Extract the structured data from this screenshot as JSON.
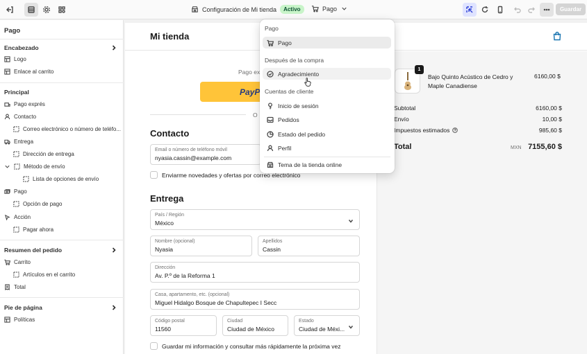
{
  "topbar": {
    "store_title": "Configuración de Mi tienda",
    "status_badge": "Activo",
    "page_selector": "Pago",
    "save_label": "Guardar"
  },
  "sidebar": {
    "title": "Pago",
    "sections": [
      {
        "label": "Encabezado",
        "items": [
          "Logo",
          "Enlace al carrito"
        ]
      },
      {
        "label": "Principal",
        "items": [
          "Pago exprés",
          "Contacto",
          "Correo electrónico o número de teléfo...",
          "Entrega",
          "Dirección de entrega",
          "Método de envío",
          "Lista de opciones de envío",
          "Pago",
          "Opción de pago",
          "Acción",
          "Pagar ahora"
        ]
      },
      {
        "label": "Resumen del pedido",
        "items": [
          "Carrito",
          "Artículos en el carrito",
          "Total"
        ]
      },
      {
        "label": "Pie de página",
        "items": [
          "Políticas"
        ]
      }
    ]
  },
  "preview": {
    "store_name": "Mi tienda",
    "express_label": "Pago ex",
    "paypal_label": "PayP",
    "or_label": "O",
    "contact_heading": "Contacto",
    "email_label": "Email o número de teléfono móvil",
    "email_value": "nyasia.cassin@example.com",
    "newsletter_label": "Enviarme novedades y ofertas por correo electrónico",
    "delivery_heading": "Entrega",
    "country_label": "País / Región",
    "country_value": "México",
    "first_name_label": "Nombre (opcional)",
    "first_name_value": "Nyasia",
    "last_name_label": "Apellidos",
    "last_name_value": "Cassin",
    "address_label": "Dirección",
    "address_value": "Av. P.º de la Reforma 1",
    "apartment_label": "Casa, apartamento, etc. (opcional)",
    "apartment_value": "Miguel Hidalgo Bosque de Chapultepec I Secc",
    "postal_label": "Código postal",
    "postal_value": "11560",
    "city_label": "Ciudad",
    "city_value": "Ciudad de México",
    "state_label": "Estado",
    "state_value": "Ciudad de Méxi...",
    "save_info_label": "Guardar mi información y consultar más rápidamente la próxima vez"
  },
  "summary": {
    "quantity": "1",
    "product_name": "Bajo Quinto Acústico de Cedro y Maple Canadiense",
    "product_price": "6160,00 $",
    "subtotal_label": "Subtotal",
    "subtotal_value": "6160,00 $",
    "shipping_label": "Envío",
    "shipping_value": "10,00 $",
    "taxes_label": "Impuestos estimados",
    "taxes_value": "985,60 $",
    "total_label": "Total",
    "total_currency": "MXN",
    "total_value": "7155,60 $"
  },
  "menu": {
    "section_checkout": "Pago",
    "item_checkout": "Pago",
    "section_after": "Después de la compra",
    "item_thanks": "Agradecimiento",
    "section_accounts": "Cuentas de cliente",
    "item_login": "Inicio de sesión",
    "item_orders": "Pedidos",
    "item_order_status": "Estado del pedido",
    "item_profile": "Perfil",
    "item_theme": "Tema de la tienda online"
  },
  "colors": {
    "accent": "#1773b0",
    "paypal": "#ffc439",
    "active_badge_bg": "#c8f4c9"
  }
}
